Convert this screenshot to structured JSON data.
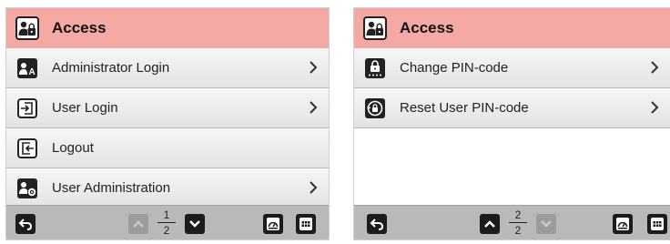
{
  "screens": [
    {
      "header": {
        "title": "Access",
        "icon": "user-lock-icon"
      },
      "menu": [
        {
          "label": "Administrator Login",
          "icon": "admin-login-icon",
          "has_chevron": true
        },
        {
          "label": "User Login",
          "icon": "login-icon",
          "has_chevron": true
        },
        {
          "label": "Logout",
          "icon": "logout-icon",
          "has_chevron": false
        },
        {
          "label": "User Administration",
          "icon": "user-settings-icon",
          "has_chevron": true
        }
      ],
      "footer": {
        "page_current": "1",
        "page_total": "2",
        "prev_enabled": false,
        "next_enabled": true
      }
    },
    {
      "header": {
        "title": "Access",
        "icon": "user-lock-icon"
      },
      "menu": [
        {
          "label": "Change PIN-code",
          "icon": "pin-lock-icon",
          "has_chevron": true
        },
        {
          "label": "Reset User PIN-code",
          "icon": "reset-lock-icon",
          "has_chevron": true
        }
      ],
      "footer": {
        "page_current": "2",
        "page_total": "2",
        "prev_enabled": true,
        "next_enabled": false
      }
    }
  ],
  "colors": {
    "header_bg": "#f4a9a5",
    "footer_bg": "#b9b9b9",
    "button": "#1c1c1c",
    "button_disabled": "#9c9c9c"
  }
}
